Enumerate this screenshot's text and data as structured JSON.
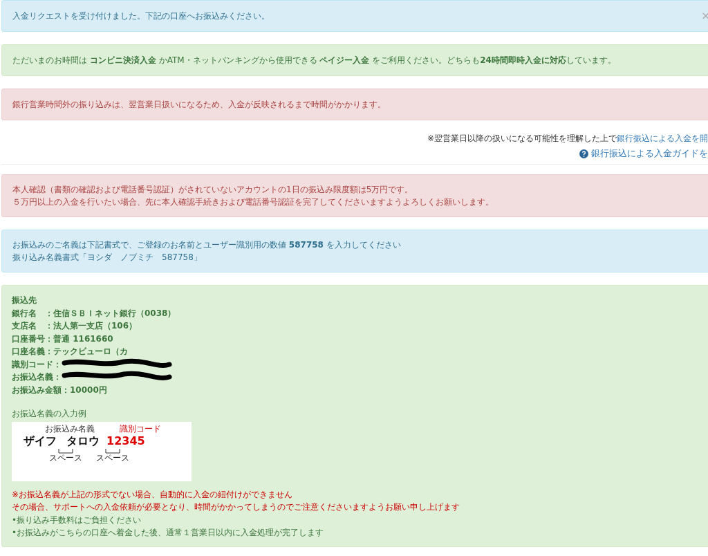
{
  "alerts_top": [
    {
      "kind": "info",
      "text": "入金リクエストを受け付けました。下記の口座へお振込みください。",
      "close": "×"
    },
    {
      "kind": "success",
      "text": "ただいまのお時間は **コンビニ決済入金** かATM・ネットバンキングから使用できる **ペイジー入金** をご利用ください。どちらも**24時間即時入金に対応**しています。"
    },
    {
      "kind": "danger",
      "text": "銀行営業時間外の振り込みは、翌営業日扱いになるため、入金が反映されるまで時間がかかります。"
    }
  ],
  "note": {
    "text": "※翌営業日以降の扱いになる可能性を理解した上で",
    "link": "銀行振込による入金を開"
  },
  "guide_link": "銀行振込による入金ガイドを",
  "alerts_mid": [
    {
      "kind": "danger",
      "lines": [
        "本人確認（書類の確認および電話番号認証）がされていないアカウントの1日の振込み限度額は5万円です。",
        "５万円以上の入金を行いたい場合、先に本人確認手続きおよび電話番号認証を完了してくださいますようよろしくお願いします。"
      ]
    },
    {
      "kind": "info",
      "lines": [
        "お振込みのご名義は下記書式で、ご登録のお名前とユーザー識別用の数値 **587758** を入力してください",
        "振り込み名義書式「ヨシダ　ノブミチ　587758」"
      ]
    }
  ],
  "transfer": {
    "heading": "振込先",
    "fields": [
      {
        "label": "銀行名　：",
        "value": "住信ＳＢＩネット銀行（0038）"
      },
      {
        "label": "支店名　：",
        "value": "法人第一支店（106）"
      },
      {
        "label": "口座番号：",
        "value": "普通 1161660"
      },
      {
        "label": "口座名義：",
        "value": "テックビューロ（カ"
      },
      {
        "label": "識別コード：",
        "redacted": true
      },
      {
        "label": "お振込名義：",
        "redacted": true
      },
      {
        "label": "お振込み金額：",
        "value": "10000円"
      }
    ],
    "example_title": "お振込名義の入力例",
    "example": {
      "name_label": "お振込み名義",
      "code_label": "識別コード",
      "name_parts": [
        "ザイフ",
        "タロウ"
      ],
      "code": "12345",
      "space_labels": [
        "スペース",
        "スペース"
      ]
    },
    "notes": [
      {
        "kind": "warning",
        "text": "※お振込名義が上記の形式でない場合、自動的に入金の紐付けができません"
      },
      {
        "kind": "warning",
        "text": "その場合、サポートへの入金依頼が必要となり、時間がかかってしまうのでご注意くださいますようお願い申し上げます"
      },
      {
        "kind": "plain",
        "text": "•振り込み手数料はご負担ください"
      },
      {
        "kind": "plain",
        "text": "•お振込みがこちらの口座へ着金した後、通常１営業日以内に入金処理が完了します"
      }
    ]
  }
}
